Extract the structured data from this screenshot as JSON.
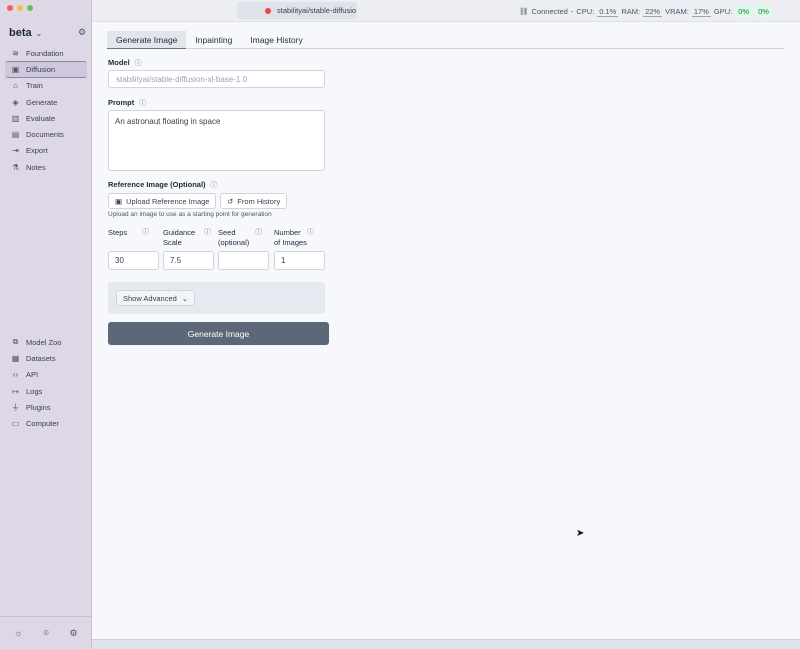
{
  "app": {
    "brand": "beta",
    "active_tab_title": "stabilityai/stable-diffusio"
  },
  "status": {
    "connected_label": "Connected",
    "cpu_label": "CPU:",
    "cpu_value": "0.1%",
    "ram_label": "RAM:",
    "ram_value": "22%",
    "vram_label": "VRAM:",
    "vram_value": "17%",
    "gpu_label": "GPU:",
    "gpu_value_1": "0%",
    "gpu_value_2": "0%"
  },
  "sidebar": {
    "items": [
      {
        "label": "Foundation",
        "icon": "layers-icon"
      },
      {
        "label": "Diffusion",
        "icon": "image-icon"
      },
      {
        "label": "Train",
        "icon": "graduation-cap-icon"
      },
      {
        "label": "Generate",
        "icon": "shapes-icon"
      },
      {
        "label": "Evaluate",
        "icon": "bar-chart-icon"
      },
      {
        "label": "Documents",
        "icon": "document-icon"
      },
      {
        "label": "Export",
        "icon": "export-icon"
      },
      {
        "label": "Notes",
        "icon": "flask-icon"
      }
    ],
    "bottom_items": [
      {
        "label": "Model Zoo",
        "icon": "boxes-icon"
      },
      {
        "label": "Datasets",
        "icon": "database-icon"
      },
      {
        "label": "API",
        "icon": "code-icon"
      },
      {
        "label": "Logs",
        "icon": "logs-icon"
      },
      {
        "label": "Plugins",
        "icon": "plug-icon"
      },
      {
        "label": "Computer",
        "icon": "monitor-icon"
      }
    ]
  },
  "main": {
    "tabs": [
      "Generate Image",
      "Inpainting",
      "Image History"
    ],
    "model_label": "Model",
    "model_value": "stabilityai/stable-diffusion-xl-base-1.0",
    "prompt_label": "Prompt",
    "prompt_value": "An astronaut floating in space",
    "reference_label": "Reference Image (Optional)",
    "upload_button": "Upload Reference Image",
    "history_button": "From History",
    "reference_hint": "Upload an image to use as a starting point for generation",
    "params": [
      {
        "label_line1": "Steps",
        "label_line2": "",
        "value": "30"
      },
      {
        "label_line1": "Guidance",
        "label_line2": "Scale",
        "value": "7.5"
      },
      {
        "label_line1": "Seed",
        "label_line2": "(optional)",
        "value": ""
      },
      {
        "label_line1": "Number",
        "label_line2": "of Images",
        "value": "1"
      }
    ],
    "advanced_button": "Show Advanced",
    "generate_button": "Generate Image"
  },
  "colors": {
    "sidebar_bg": "#ddd7e6",
    "primary_button": "#5c6778",
    "gpu_badge": "#dcfce7"
  }
}
